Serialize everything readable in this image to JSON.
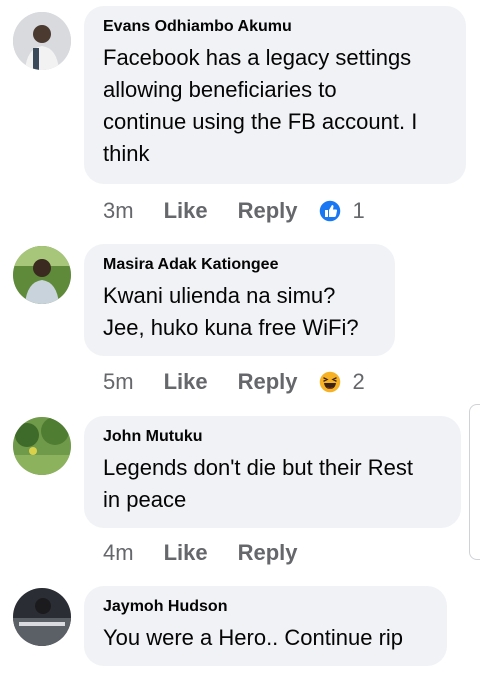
{
  "comments": [
    {
      "author": "Evans Odhiambo Akumu",
      "lines": [
        "Facebook has a legacy settings",
        "allowing beneficiaries to",
        "continue using the FB account. I",
        "think"
      ],
      "time": "3m",
      "like_label": "Like",
      "reply_label": "Reply",
      "reaction_icon": "like-icon",
      "reaction_count": "1"
    },
    {
      "author": "Masira Adak Kationgee",
      "lines": [
        "Kwani ulienda na simu?",
        "Jee, huko kuna free WiFi?"
      ],
      "time": "5m",
      "like_label": "Like",
      "reply_label": "Reply",
      "reaction_icon": "haha-icon",
      "reaction_count": "2"
    },
    {
      "author": "John Mutuku",
      "lines": [
        "Legends don't die but their Rest",
        "in peace"
      ],
      "time": "4m",
      "like_label": "Like",
      "reply_label": "Reply"
    },
    {
      "author": "Jaymoh Hudson",
      "lines": [
        "You were a Hero.. Continue rip"
      ]
    }
  ],
  "colors": {
    "bubble": "#f0f2f5",
    "meta_text": "#65676b",
    "like_blue": "#1877f2",
    "haha_yellow": "#f7b125"
  }
}
